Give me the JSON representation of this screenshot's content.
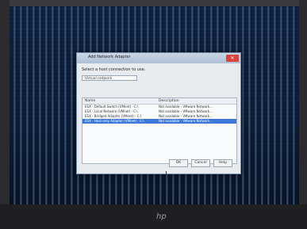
{
  "dialog": {
    "title": "Add Network Adapter",
    "prompt": "Select a host connection to use.",
    "filter_placeholder": "Virtual network",
    "columns": [
      "Name",
      "Description"
    ],
    "rows": [
      {
        "name": "ESX - Default Switch (VMnet) - C:\\",
        "desc": "Not available - VMware Network...",
        "selected": false
      },
      {
        "name": "ESX - Local Network (VMnet) - C:\\",
        "desc": "Not available - VMware Network...",
        "selected": false
      },
      {
        "name": "ESX - Bridged Adapter (VMnet) - C:\\",
        "desc": "Not available - VMware Network...",
        "selected": false
      },
      {
        "name": "ESX - Host-only Adapter (VMnet) - C:\\",
        "desc": "Not available - VMware Network...",
        "selected": true
      }
    ],
    "buttons": {
      "ok": "OK",
      "cancel": "Cancel",
      "help": "Help"
    }
  },
  "brand": {
    "logo": "hp"
  }
}
